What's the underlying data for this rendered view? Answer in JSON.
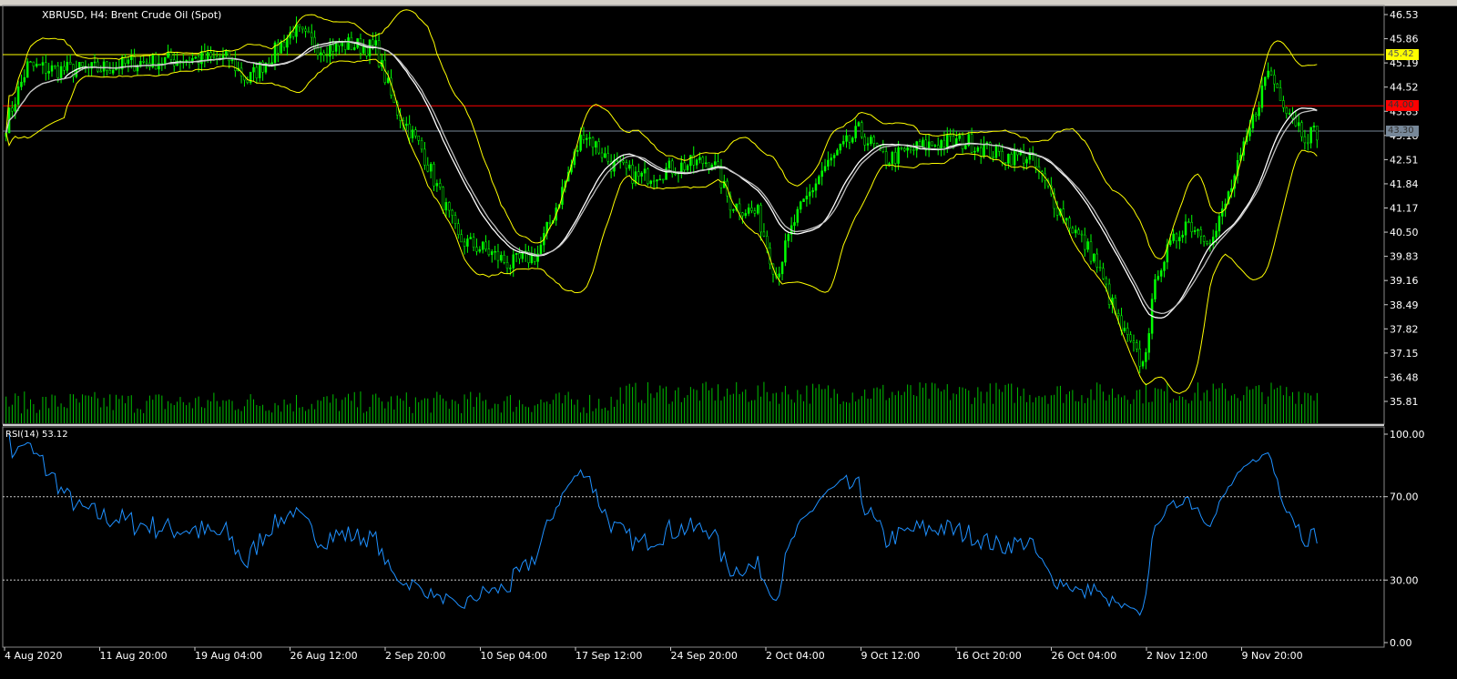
{
  "window": {
    "title": "XBRUSD, H4:  Brent Crude Oil (Spot)"
  },
  "chart_data": {
    "type": "candlestick",
    "symbol": "XBRUSD",
    "timeframe": "H4",
    "title": "Brent Crude Oil (Spot)",
    "bars": 430,
    "close_anchors": [
      [
        0,
        43.5
      ],
      [
        7,
        45.1
      ],
      [
        16,
        45.0
      ],
      [
        28,
        45.0
      ],
      [
        43,
        45.2
      ],
      [
        58,
        45.3
      ],
      [
        73,
        45.3
      ],
      [
        79,
        44.7
      ],
      [
        88,
        45.5
      ],
      [
        94,
        46.1
      ],
      [
        103,
        45.6
      ],
      [
        112,
        45.7
      ],
      [
        121,
        45.6
      ],
      [
        127,
        44.0
      ],
      [
        136,
        42.8
      ],
      [
        148,
        40.3
      ],
      [
        157,
        40.0
      ],
      [
        165,
        39.6
      ],
      [
        174,
        39.9
      ],
      [
        180,
        41.2
      ],
      [
        189,
        43.3
      ],
      [
        198,
        42.4
      ],
      [
        207,
        42.0
      ],
      [
        219,
        42.3
      ],
      [
        231,
        42.5
      ],
      [
        237,
        41.3
      ],
      [
        246,
        41.0
      ],
      [
        252,
        39.3
      ],
      [
        258,
        40.8
      ],
      [
        267,
        42.2
      ],
      [
        279,
        43.3
      ],
      [
        288,
        42.5
      ],
      [
        297,
        42.8
      ],
      [
        306,
        43.0
      ],
      [
        315,
        43.0
      ],
      [
        326,
        42.6
      ],
      [
        335,
        42.6
      ],
      [
        344,
        41.2
      ],
      [
        356,
        39.8
      ],
      [
        365,
        37.8
      ],
      [
        372,
        36.8
      ],
      [
        377,
        39.5
      ],
      [
        386,
        40.8
      ],
      [
        395,
        40.3
      ],
      [
        404,
        42.5
      ],
      [
        413,
        45.0
      ],
      [
        419,
        44.0
      ],
      [
        425,
        43.2
      ],
      [
        430,
        43.3
      ]
    ],
    "y_axis": {
      "ticks": [
        "46.53",
        "45.86",
        "45.19",
        "44.52",
        "43.85",
        "43.18",
        "42.51",
        "41.84",
        "41.17",
        "40.50",
        "39.83",
        "39.16",
        "38.49",
        "37.82",
        "37.15",
        "36.48",
        "35.81"
      ],
      "range": [
        35.81,
        46.53
      ]
    },
    "hlines": [
      {
        "value": "45.42",
        "color": "#ffff00"
      },
      {
        "value": "44.00",
        "color": "#ff0000"
      },
      {
        "value": "43.30",
        "color": "#778899"
      }
    ],
    "x_axis": {
      "ticks": [
        "4 Aug 2020",
        "11 Aug 20:00",
        "19 Aug 04:00",
        "26 Aug 12:00",
        "2 Sep 20:00",
        "10 Sep 04:00",
        "17 Sep 12:00",
        "24 Sep 20:00",
        "2 Oct 04:00",
        "9 Oct 12:00",
        "16 Oct 20:00",
        "26 Oct 04:00",
        "2 Nov 12:00",
        "9 Nov 20:00"
      ]
    },
    "indicators": {
      "bollinger": {
        "period": 20,
        "dev": 2,
        "color": "#ffff00"
      },
      "ma": [
        {
          "period": 20,
          "color": "#ffffff"
        },
        {
          "period": 22,
          "color": "#c0c0c0"
        }
      ],
      "volume": {
        "color": "#00c000"
      }
    },
    "rsi": {
      "label": "RSI(14) 53.12",
      "period": 14,
      "levels": [
        70,
        30
      ],
      "ticks": [
        "100.00",
        "70.00",
        "30.00",
        "0.00"
      ],
      "color": "#1e90ff"
    },
    "colors": {
      "bull": "#00ff00",
      "bear": "#ffffff",
      "background": "#000000"
    }
  }
}
